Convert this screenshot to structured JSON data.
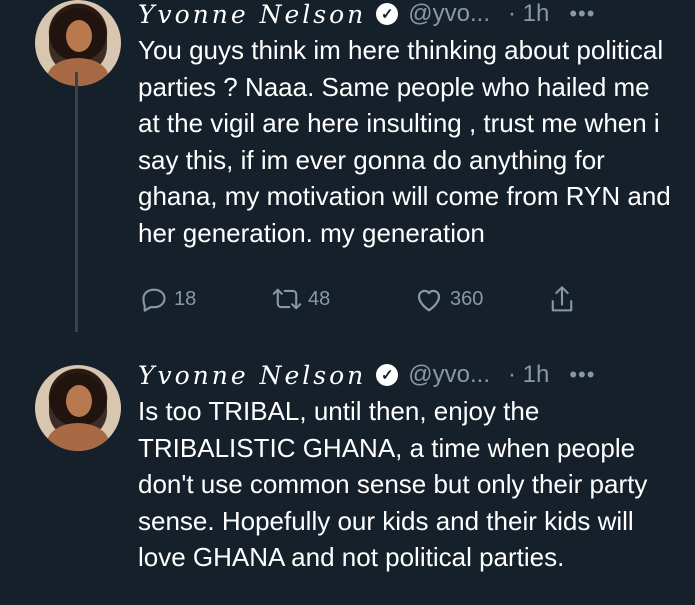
{
  "tweet1": {
    "name": "Yvonne Nelson",
    "handle": "@yvo...",
    "time": "· 1h",
    "more": "•••",
    "text": "You guys think im here thinking about political parties ? Naaa. Same people who hailed me at the vigil are here insulting , trust me when i say this, if im ever gonna do anything for ghana, my motivation will come from RYN and her generation. my generation",
    "replies": "18",
    "retweets": "48",
    "likes": "360"
  },
  "tweet2": {
    "name": "Yvonne Nelson",
    "handle": "@yvo...",
    "time": "· 1h",
    "more": "•••",
    "text": "Is too TRIBAL, until then, enjoy the TRIBALISTIC GHANA, a time when people don't use common sense but only their party sense. Hopefully our kids and their kids will love GHANA and not political parties."
  },
  "colors": {
    "background": "#15202b",
    "text": "#ffffff",
    "muted": "#8899a6",
    "thread_line": "#38444d"
  },
  "icons": {
    "reply": "reply-icon",
    "retweet": "retweet-icon",
    "like": "heart-icon",
    "share": "share-icon",
    "verified": "verified-badge-icon"
  }
}
